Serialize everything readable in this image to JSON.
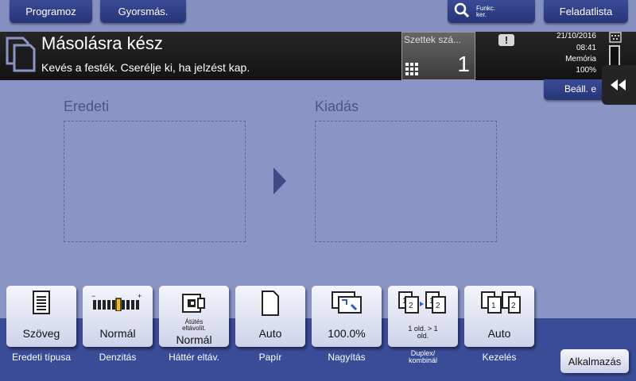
{
  "topbar": {
    "programs_label": "Programoz",
    "quick_label": "Gyorsmás.",
    "func_key_label": "Funkc. ker.",
    "job_list_label": "Feladatlista"
  },
  "status": {
    "title": "Másolásra kész",
    "message": "Kevés a festék. Cserélje ki, ha jelzést kap.",
    "sets_label": "Szettek szá...",
    "sets_value": "1",
    "date": "21/10/2016",
    "time": "08:41",
    "memory_label": "Memória",
    "memory_value": "100%",
    "settings_label": "Beáll. e"
  },
  "main": {
    "original_title": "Eredeti",
    "output_title": "Kiadás"
  },
  "functions": [
    {
      "value": "Szöveg",
      "label": "Eredeti típusa",
      "icon": "document-icon"
    },
    {
      "value": "Normál",
      "label": "Denzitás",
      "icon": "density-scale-icon"
    },
    {
      "value_small": "Átütés eltávolít.",
      "value": "Normál",
      "label": "Háttér eltáv.",
      "icon": "background-removal-icon"
    },
    {
      "value": "Auto",
      "label": "Papír",
      "icon": "paper-icon"
    },
    {
      "value": "100.0%",
      "label": "Nagyítás",
      "icon": "zoom-icon"
    },
    {
      "value": "1 old. > 1 old.",
      "label": "Duplex/ kombinál",
      "icon": "duplex-icon"
    },
    {
      "value": "Auto",
      "label": "Kezelés",
      "icon": "finishing-icon"
    }
  ],
  "apply_label": "Alkalmazás",
  "colors": {
    "accent": "#2f3f8a",
    "background": "#8a95c6",
    "status_bar": "#1b1b1b"
  }
}
